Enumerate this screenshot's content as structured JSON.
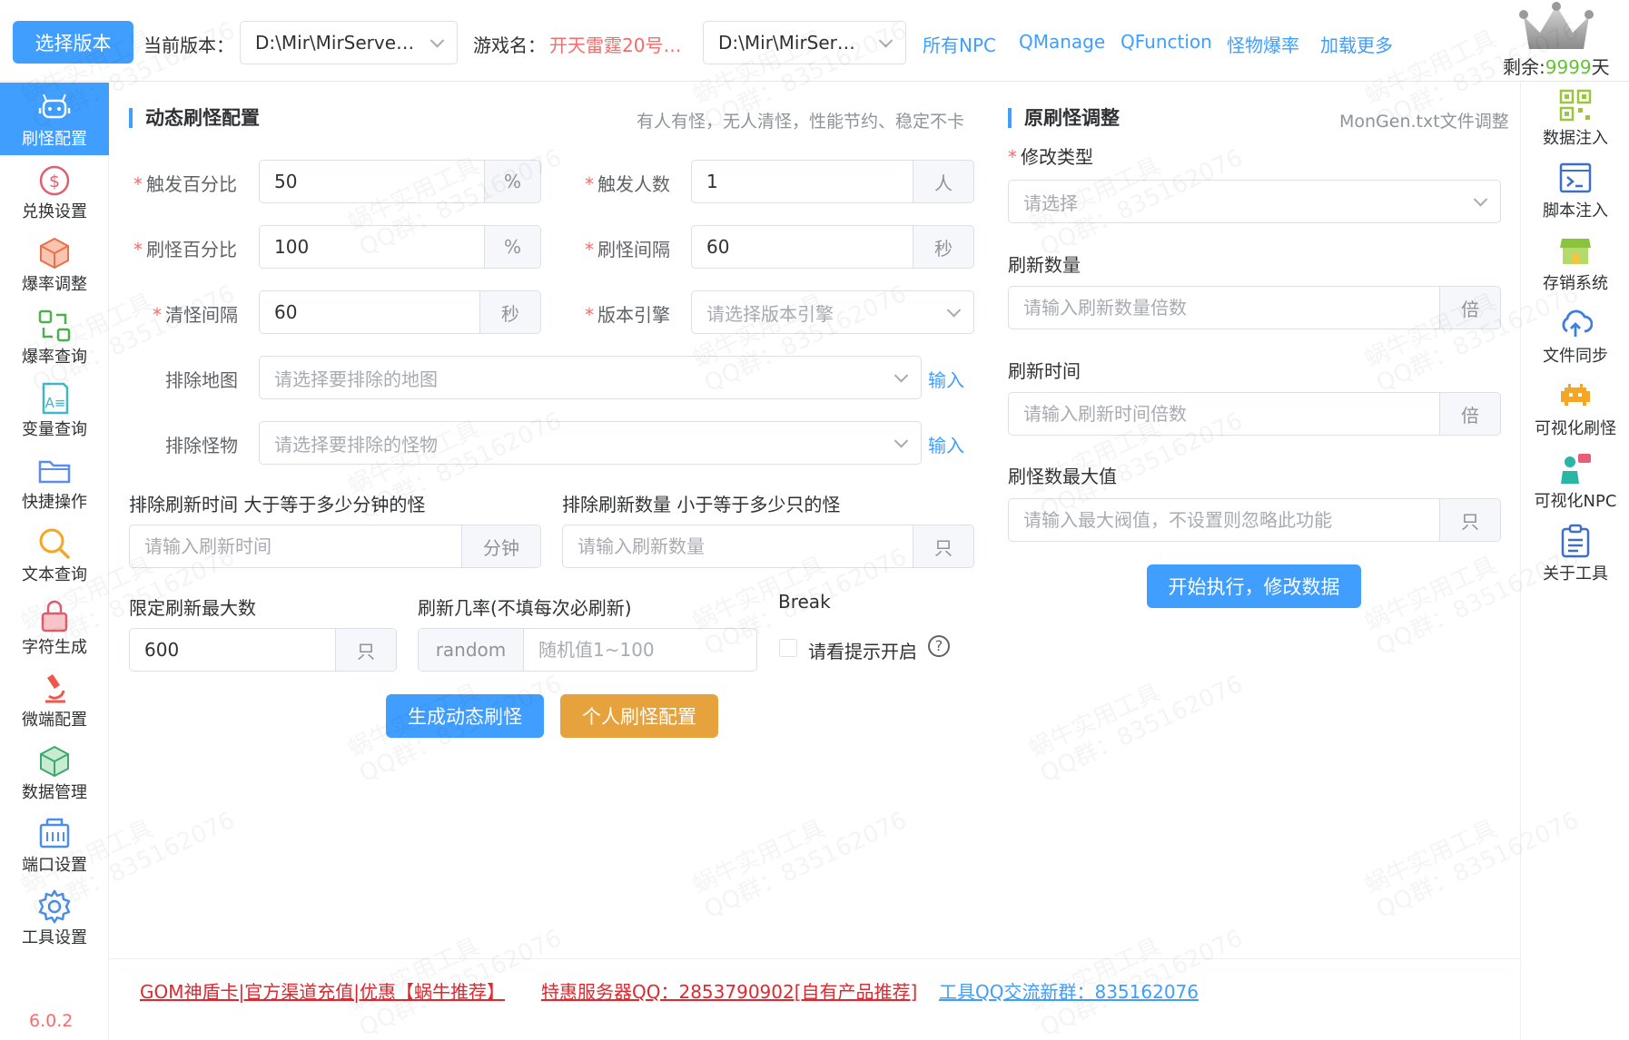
{
  "header": {
    "select_version_btn": "选择版本",
    "current_version_label": "当前版本：",
    "current_version_value": "D:\\Mir\\MirServer…",
    "game_name_label": "游戏名：",
    "game_name_value": "开天雷霆20号…",
    "server_path_value": "D:\\Mir\\MirServ…",
    "links": [
      "所有NPC",
      "QManage",
      "QFunction",
      "怪物爆率",
      "加载更多"
    ],
    "remain_prefix": "剩余:",
    "remain_days": "9999",
    "remain_suffix": "天"
  },
  "left_nav": [
    {
      "label": "刷怪配置",
      "icon": "robot-icon",
      "active": true
    },
    {
      "label": "兑换设置",
      "icon": "dollar-icon"
    },
    {
      "label": "爆率调整",
      "icon": "cube-icon"
    },
    {
      "label": "爆率查询",
      "icon": "exchange-icon"
    },
    {
      "label": "变量查询",
      "icon": "text-var-icon"
    },
    {
      "label": "快捷操作",
      "icon": "folder-icon"
    },
    {
      "label": "文本查询",
      "icon": "search-icon"
    },
    {
      "label": "字符生成",
      "icon": "lock-icon"
    },
    {
      "label": "微端配置",
      "icon": "microscope-icon"
    },
    {
      "label": "数据管理",
      "icon": "box-icon"
    },
    {
      "label": "端口设置",
      "icon": "port-icon"
    },
    {
      "label": "工具设置",
      "icon": "gear-icon"
    }
  ],
  "app_version": "6.0.2",
  "right_nav": [
    {
      "label": "数据注入",
      "icon": "qrcode-icon"
    },
    {
      "label": "脚本注入",
      "icon": "terminal-icon"
    },
    {
      "label": "存销系统",
      "icon": "store-icon"
    },
    {
      "label": "文件同步",
      "icon": "cloud-upload-icon"
    },
    {
      "label": "可视化刷怪",
      "icon": "space-invader-icon"
    },
    {
      "label": "可视化NPC",
      "icon": "npc-chat-icon"
    },
    {
      "label": "关于工具",
      "icon": "clipboard-icon"
    }
  ],
  "dynamic": {
    "title": "动态刷怪配置",
    "note": "有人有怪，无人清怪，性能节约、稳定不卡",
    "trigger_percent_label": "触发百分比",
    "trigger_percent_value": "50",
    "trigger_percent_unit": "%",
    "trigger_players_label": "触发人数",
    "trigger_players_value": "1",
    "trigger_players_unit": "人",
    "spawn_percent_label": "刷怪百分比",
    "spawn_percent_value": "100",
    "spawn_percent_unit": "%",
    "spawn_interval_label": "刷怪间隔",
    "spawn_interval_value": "60",
    "spawn_interval_unit": "秒",
    "clear_interval_label": "清怪间隔",
    "clear_interval_value": "60",
    "clear_interval_unit": "秒",
    "engine_label": "版本引擎",
    "engine_placeholder": "请选择版本引擎",
    "exclude_map_label": "排除地图",
    "exclude_map_placeholder": "请选择要排除的地图",
    "exclude_monster_label": "排除怪物",
    "exclude_monster_placeholder": "请选择要排除的怪物",
    "input_link": "输入",
    "exclude_time_label": "排除刷新时间 大于等于多少分钟的怪",
    "exclude_time_placeholder": "请输入刷新时间",
    "exclude_time_unit": "分钟",
    "exclude_count_label": "排除刷新数量 小于等于多少只的怪",
    "exclude_count_placeholder": "请输入刷新数量",
    "exclude_count_unit": "只",
    "max_refresh_label": "限定刷新最大数",
    "max_refresh_value": "600",
    "max_refresh_unit": "只",
    "probability_label": "刷新几率(不填每次必刷新)",
    "probability_prefix": "random",
    "probability_placeholder": "随机值1~100",
    "break_label": "Break",
    "break_checkbox_label": "请看提示开启",
    "help_glyph": "?",
    "generate_btn": "生成动态刷怪",
    "personal_btn": "个人刷怪配置"
  },
  "original": {
    "title": "原刷怪调整",
    "note": "MonGen.txt文件调整",
    "modify_type_label": "修改类型",
    "modify_type_placeholder": "请选择",
    "refresh_count_label": "刷新数量",
    "refresh_count_placeholder": "请输入刷新数量倍数",
    "refresh_count_unit": "倍",
    "refresh_time_label": "刷新时间",
    "refresh_time_placeholder": "请输入刷新时间倍数",
    "refresh_time_unit": "倍",
    "max_spawn_label": "刷怪数最大值",
    "max_spawn_placeholder": "请输入最大阀值，不设置则忽略此功能",
    "max_spawn_unit": "只",
    "execute_btn": "开始执行，修改数据"
  },
  "footer": {
    "link1": "GOM神盾卡|官方渠道充值|优惠【蜗牛推荐】",
    "link2": "特惠服务器QQ：2853790902[自有产品推荐]",
    "link3": "工具QQ交流新群：835162076"
  },
  "watermark": "蜗牛实用工具\nQQ群：835162076",
  "colors": {
    "primary": "#409eff",
    "warning": "#e6a23c",
    "danger": "#f56c6c",
    "success": "#67c23a"
  }
}
